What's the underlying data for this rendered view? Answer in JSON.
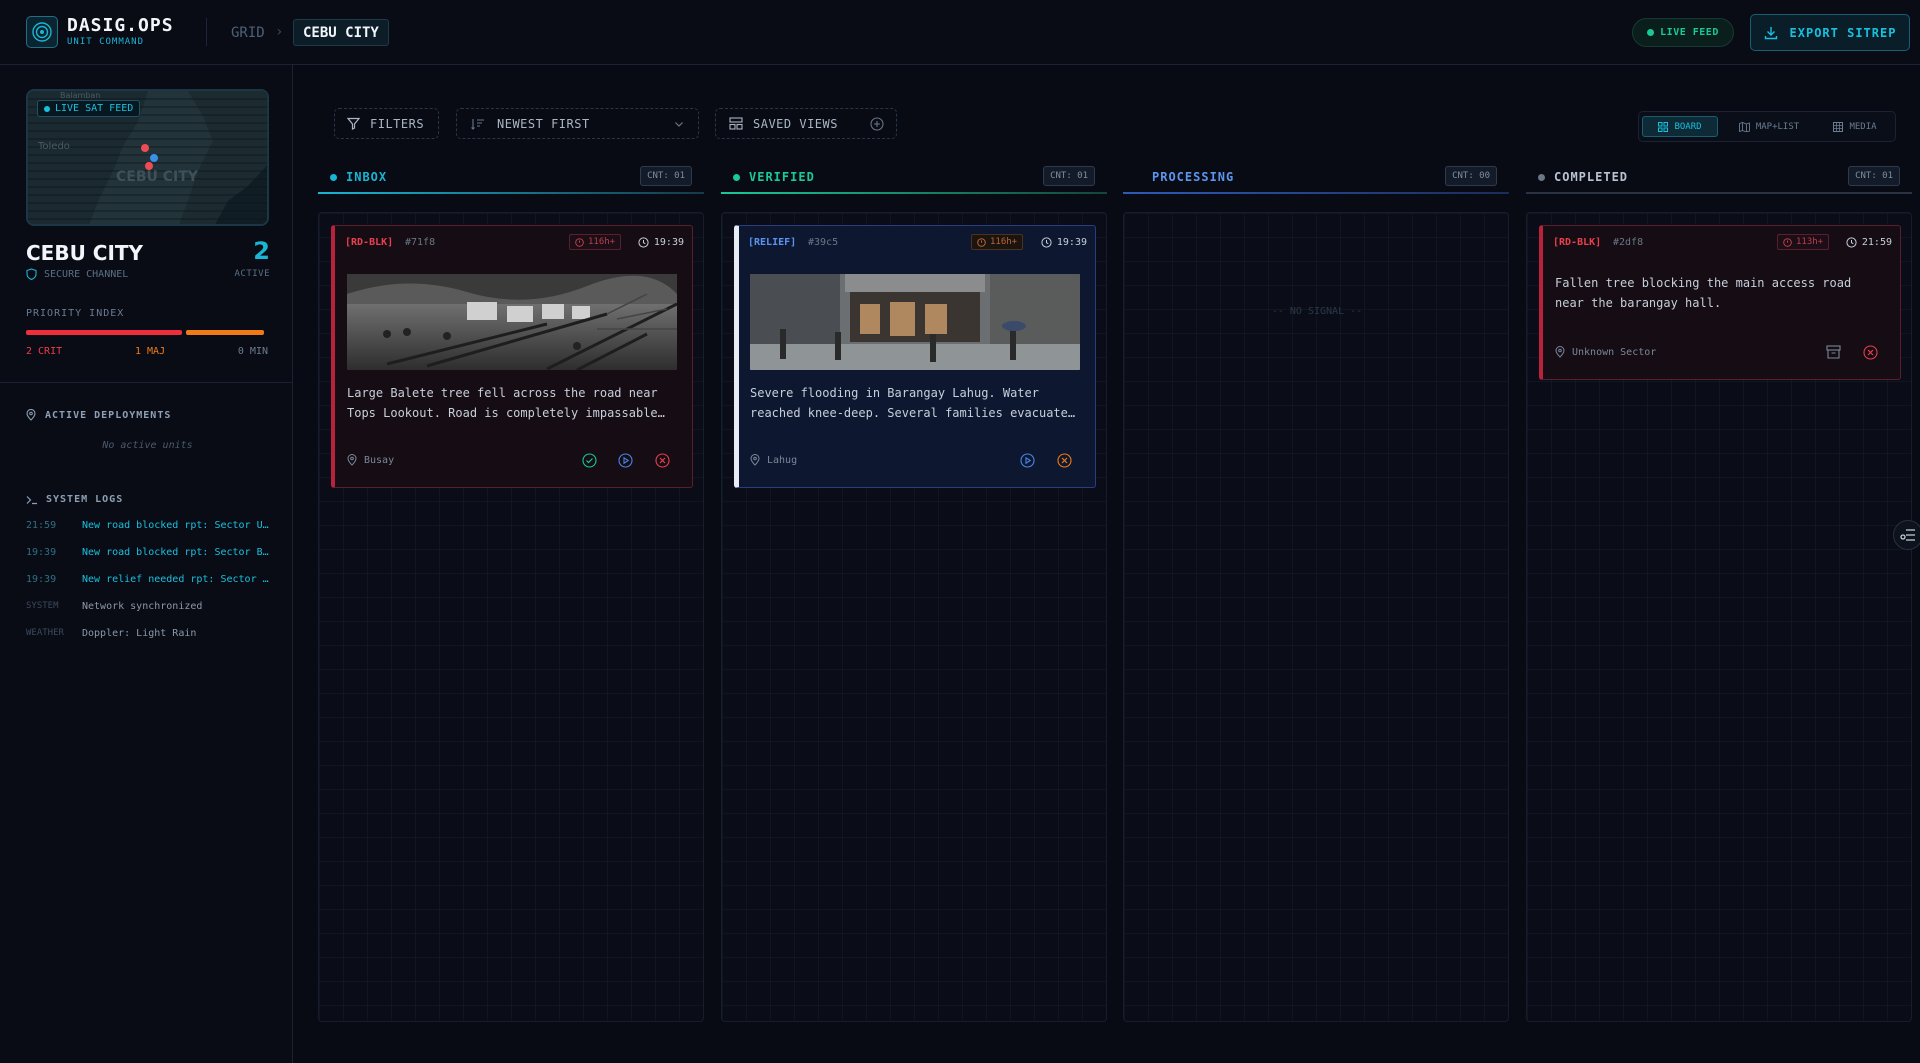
{
  "header": {
    "logo_title": "DASIG.OPS",
    "logo_subtitle": "UNIT COMMAND",
    "breadcrumb_root": "GRID",
    "breadcrumb_sep": "›",
    "breadcrumb_current": "CEBU CITY",
    "live_feed_label": "LIVE FEED",
    "export_label": "EXPORT SITREP"
  },
  "sidebar": {
    "map": {
      "badge": "LIVE SAT FEED",
      "label_city": "CEBU CITY",
      "label_toledo": "Toledo",
      "label_balamban": "Balamban"
    },
    "city_name": "CEBU CITY",
    "secure_label": "SECURE CHANNEL",
    "active_count": "2",
    "active_label": "ACTIVE",
    "priority": {
      "title": "PRIORITY INDEX",
      "crit": "2 CRIT",
      "maj": "1 MAJ",
      "min": "0 MIN"
    },
    "deployments": {
      "title": "ACTIVE DEPLOYMENTS",
      "empty": "No active units"
    },
    "logs": {
      "title": "SYSTEM LOGS",
      "entries": [
        {
          "time": "21:59",
          "text": "New road blocked rpt: Sector Unknown"
        },
        {
          "time": "19:39",
          "text": "New road blocked rpt: Sector Busay"
        },
        {
          "time": "19:39",
          "text": "New relief needed rpt: Sector Lahug"
        },
        {
          "time": "SYSTEM",
          "text": "Network synchronized"
        },
        {
          "time": "WEATHER",
          "text": "Doppler: Light Rain"
        }
      ]
    }
  },
  "toolbar": {
    "filters": "FILTERS",
    "sort": "NEWEST FIRST",
    "saved_views": "SAVED VIEWS",
    "views": {
      "board": "BOARD",
      "map_list": "MAP+LIST",
      "media": "MEDIA"
    }
  },
  "columns": [
    {
      "title": "INBOX",
      "count": "CNT: 01",
      "color": "#19b5d3"
    },
    {
      "title": "VERIFIED",
      "count": "CNT: 01",
      "color": "#19c996"
    },
    {
      "title": "PROCESSING",
      "count": "CNT: 00",
      "color": "#4a86e8",
      "empty": "-- NO SIGNAL --"
    },
    {
      "title": "COMPLETED",
      "count": "CNT: 01",
      "color": "#8a95a5"
    }
  ],
  "cards": {
    "inbox": {
      "tag": "[RD-BLK]",
      "id": "#71f8",
      "age": "116h+",
      "time": "19:39",
      "text": "Large Balete tree fell across the road near Tops Lookout. Road is completely impassable for vehicles.",
      "location": "Busay"
    },
    "verified": {
      "tag": "[RELIEF]",
      "id": "#39c5",
      "age": "116h+",
      "time": "19:39",
      "text": "Severe flooding in Barangay Lahug. Water reached knee-deep. Several families evacuated to the covered court.",
      "location": "Lahug"
    },
    "completed": {
      "tag": "[RD-BLK]",
      "id": "#2df8",
      "age": "113h+",
      "time": "21:59",
      "text": "Fallen tree blocking the main access road near the barangay hall.",
      "location": "Unknown Sector"
    }
  }
}
